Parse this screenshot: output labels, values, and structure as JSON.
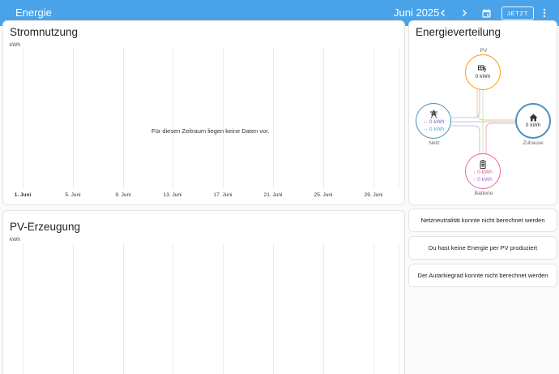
{
  "header": {
    "title": "Energie",
    "period": "Juni 2025",
    "prev_icon": "chevron-left-icon",
    "next_icon": "chevron-right-icon",
    "calendar_icon": "calendar-icon",
    "now_label": "JETZT",
    "menu_icon": "more-vertical-icon",
    "color": "#4aa3e8"
  },
  "usage_card": {
    "title": "Stromnutzung",
    "unit": "kWh",
    "no_data": "Für diesen Zeitraum liegen keine Daten vor.",
    "ticks": [
      "1. Juni",
      "5. Juni",
      "9. Juni",
      "13. Juni",
      "17. Juni",
      "21. Juni",
      "25. Juni",
      "29. Juni"
    ]
  },
  "pv_card": {
    "title": "PV-Erzeugung",
    "unit": "kWh"
  },
  "distribution": {
    "title": "Energieverteilung",
    "pv": {
      "label": "PV",
      "value": "0 kWh",
      "color": "#ff9800",
      "icon": "solar-power-icon"
    },
    "grid": {
      "label": "Netz",
      "value_in": "← 0 kWh",
      "value_out": "→ 0 kWh",
      "color": "#488fc2",
      "icon": "transmission-tower-icon"
    },
    "home": {
      "label": "Zuhause",
      "value": "0 kWh",
      "color": "#488fc2",
      "icon": "home-icon"
    },
    "battery": {
      "label": "Batterie",
      "value_in": "↓ 0 kWh",
      "value_out": "↑ 0 kWh",
      "color": "#f06292",
      "icon": "battery-icon"
    }
  },
  "messages": {
    "grid_neutrality": "Netzneutralität konnte nicht berechnet werden",
    "no_pv": "Du hast keine Energie per PV produziert",
    "autarky": "Der Autarkiegrad konnte nicht berechnet werden"
  }
}
